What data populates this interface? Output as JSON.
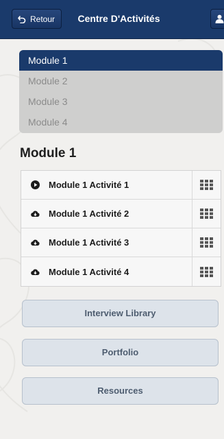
{
  "header": {
    "back_label": "Retour",
    "title": "Centre D'Activités",
    "back_icon": "undo-arrow-icon",
    "profile_icon": "user-icon"
  },
  "modules": [
    {
      "label": "Module 1",
      "active": true
    },
    {
      "label": "Module 2",
      "active": false
    },
    {
      "label": "Module 3",
      "active": false
    },
    {
      "label": "Module 4",
      "active": false
    }
  ],
  "section": {
    "title": "Module 1"
  },
  "activities": [
    {
      "label": "Module 1 Activité 1",
      "icon": "play-circle-icon"
    },
    {
      "label": "Module 1 Activité 2",
      "icon": "cloud-download-icon"
    },
    {
      "label": "Module 1 Activité 3",
      "icon": "cloud-download-icon"
    },
    {
      "label": "Module 1 Activité 4",
      "icon": "cloud-download-icon"
    }
  ],
  "nav_buttons": {
    "interview_library": "Interview Library",
    "portfolio": "Portfolio",
    "resources": "Resources"
  },
  "colors": {
    "header_bg": "#1a3a6b",
    "active_module_bg": "#1a3a6b",
    "inactive_module_bg": "#cfcfce",
    "button_bg": "#dde3ea",
    "button_text": "#4e5d70"
  }
}
